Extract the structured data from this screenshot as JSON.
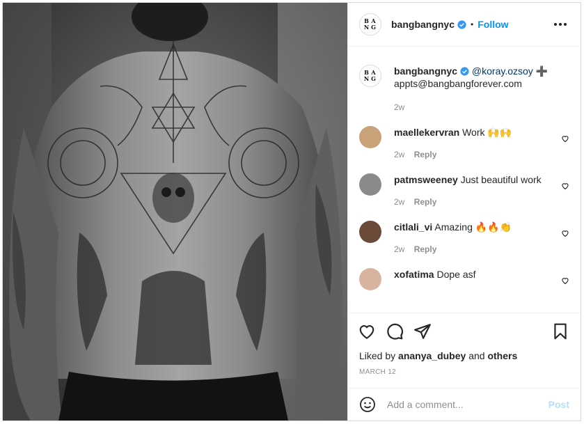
{
  "post": {
    "username": "bangbangnyc",
    "follow_label": "Follow",
    "separator": "•",
    "logo_letters": [
      "B",
      "A",
      "N",
      "G"
    ],
    "caption": {
      "mention": "@koray.ozsoy",
      "symbol": "➕",
      "email": "appts@bangbangforever.com",
      "time": "2w"
    },
    "comments": [
      {
        "username": "maellekervran",
        "text": "Work 🙌🙌",
        "time": "2w",
        "reply_label": "Reply",
        "avatar_color": "#c9a27a"
      },
      {
        "username": "patmsweeney",
        "text": "Just beautiful work",
        "time": "2w",
        "reply_label": "Reply",
        "avatar_color": "#8a8a8a"
      },
      {
        "username": "citlali_vi",
        "text": "Amazing 🔥🔥👏",
        "time": "2w",
        "reply_label": "Reply",
        "avatar_color": "#6b4a3a"
      },
      {
        "username": "xofatima",
        "text": "Dope asf",
        "avatar_color": "#d8b4a0"
      }
    ],
    "likes": {
      "prefix": "Liked by",
      "user": "ananya_dubey",
      "conjunction": "and",
      "others": "others"
    },
    "date": "MARCH 12",
    "add_comment": {
      "placeholder": "Add a comment...",
      "post_label": "Post"
    },
    "icons": {
      "verified": "verified-badge-icon",
      "more": "more-options-icon",
      "like": "heart-icon",
      "comment": "comment-icon",
      "share": "share-icon",
      "save": "bookmark-icon",
      "emoji": "emoji-icon"
    },
    "colors": {
      "accent": "#0095f6",
      "verified": "#3897f0",
      "muted": "#8e8e8e",
      "post_disabled": "#b2dffc"
    }
  }
}
